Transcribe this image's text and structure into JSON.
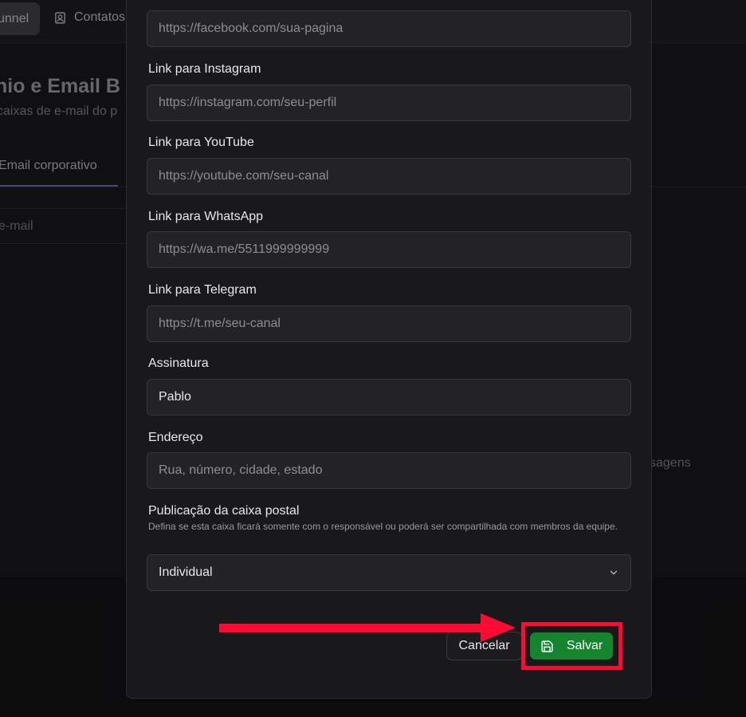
{
  "background": {
    "nav_active_label": "unnel",
    "nav_contacts_label": "Contatos",
    "page_title": "nio e Email B",
    "page_subtitle": "caixas de e-mail do p",
    "tab_label": "Email corporativo",
    "row_label": "e-mail",
    "side_text": "sagens"
  },
  "form": {
    "facebook": {
      "placeholder": "https://facebook.com/sua-pagina"
    },
    "instagram": {
      "label": "Link para Instagram",
      "placeholder": "https://instagram.com/seu-perfil"
    },
    "youtube": {
      "label": "Link para YouTube",
      "placeholder": "https://youtube.com/seu-canal"
    },
    "whatsapp": {
      "label": "Link para WhatsApp",
      "placeholder": "https://wa.me/5511999999999"
    },
    "telegram": {
      "label": "Link para Telegram",
      "placeholder": "https://t.me/seu-canal"
    },
    "signature": {
      "label": "Assinatura",
      "value": "Pablo"
    },
    "address": {
      "label": "Endereço",
      "placeholder": "Rua, número, cidade, estado"
    },
    "mailbox_publication": {
      "label": "Publicação da caixa postal",
      "help": "Defina se esta caixa ficará somente com o responsável ou poderá ser compartilhada com membros da equipe.",
      "selected": "Individual"
    }
  },
  "actions": {
    "cancel_label": "Cancelar",
    "save_label": "Salvar"
  },
  "colors": {
    "save_button": "#14852e",
    "annotation": "#ff0a33"
  }
}
